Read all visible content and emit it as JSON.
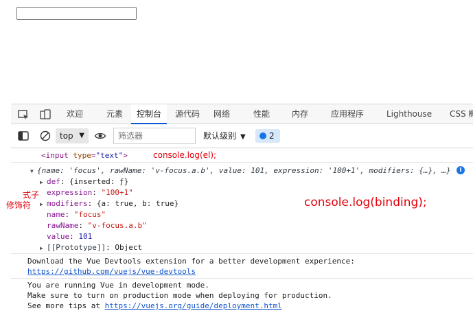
{
  "page": {
    "input_value": ""
  },
  "devtools": {
    "tabs": [
      {
        "label": "欢迎"
      },
      {
        "label": "元素"
      },
      {
        "label": "控制台"
      },
      {
        "label": "源代码"
      },
      {
        "label": "网络"
      },
      {
        "label": "性能"
      },
      {
        "label": "内存"
      },
      {
        "label": "应用程序"
      },
      {
        "label": "Lighthouse"
      },
      {
        "label": "CSS 概"
      }
    ],
    "active_tab": "控制台",
    "toolbar": {
      "context": "top",
      "filter_placeholder": "筛选器",
      "level": "默认级别",
      "message_count": "2"
    },
    "accent_color": "#0b57d0"
  },
  "console": {
    "el_line": {
      "tag_open": "<input ",
      "attr_name": "type",
      "attr_eq": "=",
      "attr_value": "\"text\"",
      "tag_close": ">"
    },
    "binding_summary": "{name: 'focus', rawName: 'v-focus.a.b', value: 101, expression: '100+1', modifiers: {…}, …}",
    "binding_props": [
      {
        "key": "def",
        "value": "{inserted: ƒ}"
      },
      {
        "key": "expression",
        "value": "\"100+1\""
      },
      {
        "key": "modifiers",
        "value": "{a: true, b: true}"
      },
      {
        "key": "name",
        "value": "\"focus\""
      },
      {
        "key": "rawName",
        "value": "\"v-focus.a.b\""
      },
      {
        "key": "value",
        "value": "101"
      },
      {
        "key": "[[Prototype]]",
        "value": "Object"
      }
    ],
    "devtools_msg": "Download the Vue Devtools extension for a better development experience:",
    "devtools_link": "https://github.com/vuejs/vue-devtools",
    "devmode_line1": "You are running Vue in development mode.",
    "devmode_line2": "Make sure to turn on production mode when deploying for production.",
    "devmode_line3_prefix": "See more tips at ",
    "devmode_link": "https://vuejs.org/guide/deployment.html"
  },
  "annotations": {
    "el_note": "console.log(el);",
    "binding_note": "console.log(binding);",
    "expression_note": "式子",
    "modifiers_note": "修饰符",
    "color": "#e3000b"
  }
}
